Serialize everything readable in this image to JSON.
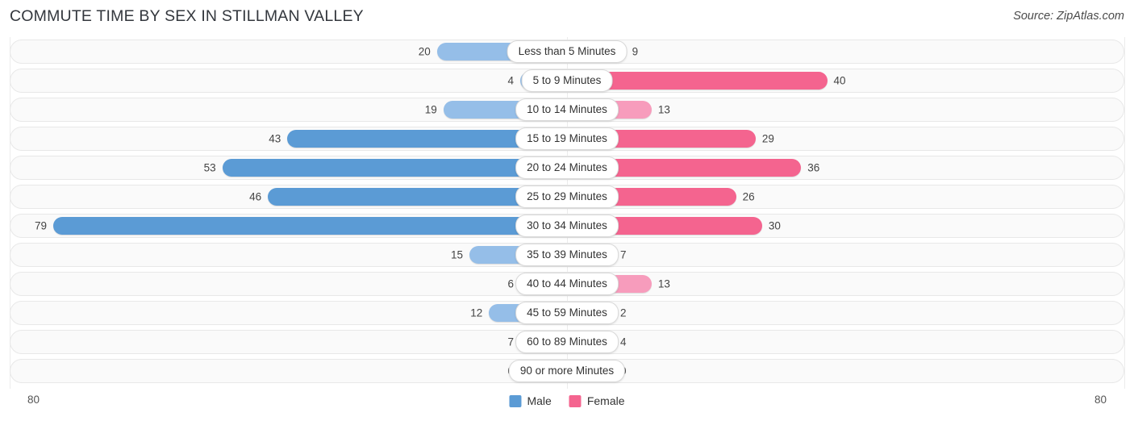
{
  "header": {
    "title": "COMMUTE TIME BY SEX IN STILLMAN VALLEY",
    "source": "Source: ZipAtlas.com"
  },
  "legend": {
    "male_label": "Male",
    "female_label": "Female",
    "male_color": "#5b9bd5",
    "female_color": "#f4648f"
  },
  "axis": {
    "left_max": "80",
    "right_max": "80"
  },
  "colors": {
    "male_light": "#95bee8",
    "male_dark": "#5b9bd5",
    "female_light": "#f79cbc",
    "female_dark": "#f4648f"
  },
  "chart_data": {
    "type": "bar",
    "orientation": "horizontal-diverging",
    "title": "COMMUTE TIME BY SEX IN STILLMAN VALLEY",
    "xlabel": "",
    "ylabel": "",
    "xlim": [
      80,
      80
    ],
    "grid": true,
    "legend_position": "bottom-center",
    "categories": [
      "Less than 5 Minutes",
      "5 to 9 Minutes",
      "10 to 14 Minutes",
      "15 to 19 Minutes",
      "20 to 24 Minutes",
      "25 to 29 Minutes",
      "30 to 34 Minutes",
      "35 to 39 Minutes",
      "40 to 44 Minutes",
      "45 to 59 Minutes",
      "60 to 89 Minutes",
      "90 or more Minutes"
    ],
    "series": [
      {
        "name": "Male",
        "values": [
          20,
          4,
          19,
          43,
          53,
          46,
          79,
          15,
          6,
          12,
          7,
          0
        ]
      },
      {
        "name": "Female",
        "values": [
          9,
          40,
          13,
          29,
          36,
          26,
          30,
          7,
          13,
          2,
          4,
          0
        ]
      }
    ]
  },
  "rows": [
    {
      "category": "Less than 5 Minutes",
      "male": "20",
      "female": "9"
    },
    {
      "category": "5 to 9 Minutes",
      "male": "4",
      "female": "40"
    },
    {
      "category": "10 to 14 Minutes",
      "male": "19",
      "female": "13"
    },
    {
      "category": "15 to 19 Minutes",
      "male": "43",
      "female": "29"
    },
    {
      "category": "20 to 24 Minutes",
      "male": "53",
      "female": "36"
    },
    {
      "category": "25 to 29 Minutes",
      "male": "46",
      "female": "26"
    },
    {
      "category": "30 to 34 Minutes",
      "male": "79",
      "female": "30"
    },
    {
      "category": "35 to 39 Minutes",
      "male": "15",
      "female": "7"
    },
    {
      "category": "40 to 44 Minutes",
      "male": "6",
      "female": "13"
    },
    {
      "category": "45 to 59 Minutes",
      "male": "12",
      "female": "2"
    },
    {
      "category": "60 to 89 Minutes",
      "male": "7",
      "female": "4"
    },
    {
      "category": "90 or more Minutes",
      "male": "0",
      "female": "0"
    }
  ]
}
